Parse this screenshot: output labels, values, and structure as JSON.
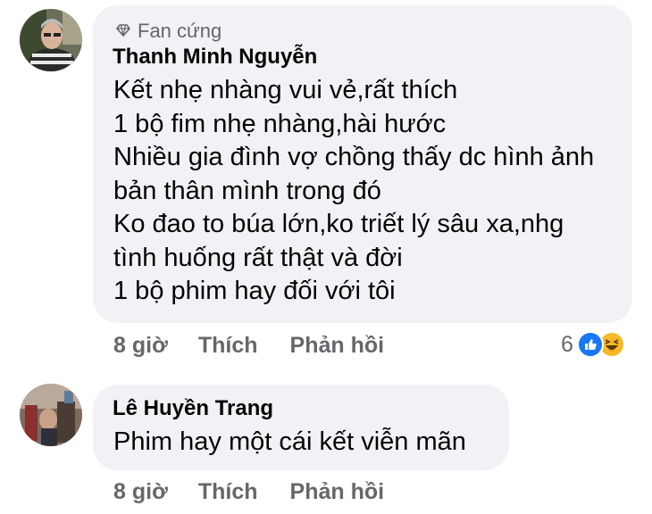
{
  "comments": [
    {
      "badge": "Fan cứng",
      "author": "Thanh Minh Nguyễn",
      "lines": [
        "Kết nhẹ nhàng vui vẻ,rất thích",
        "1 bộ fim nhẹ nhàng,hài hước",
        "Nhiều gia đình vợ chồng thấy dc hình ảnh",
        "bản thân mình trong đó",
        "Ko đao to búa lớn,ko triết lý sâu xa,nhg",
        "tình huống rất thật và đời",
        "1 bộ phim hay đối với tôi"
      ],
      "time": "8 giờ",
      "like_label": "Thích",
      "reply_label": "Phản hồi",
      "reaction_count": "6",
      "reaction_icons": [
        "like-icon",
        "haha-icon"
      ]
    },
    {
      "author": "Lê Huyền Trang",
      "lines": [
        "Phim hay một cái kết viễn mãn"
      ],
      "time": "8 giờ",
      "like_label": "Thích",
      "reply_label": "Phản hồi"
    }
  ],
  "colors": {
    "bubble": "#f0f2f5",
    "secondary_text": "#65676b",
    "like_blue": "#1877f2",
    "haha_yellow": "#f7b928"
  }
}
